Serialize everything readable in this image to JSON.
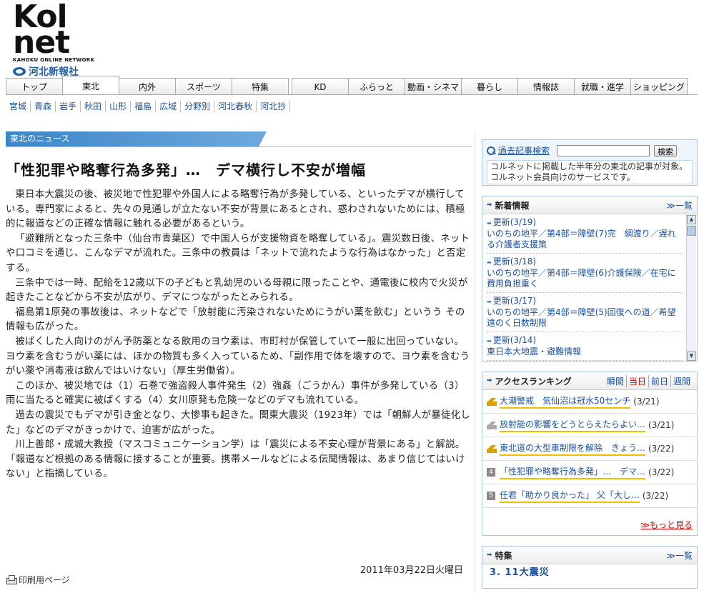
{
  "header": {
    "logo_top": "Kol",
    "logo_bottom": "net",
    "logo_sub": "KAHOKU ONLINE NETWORK",
    "publisher": "河北新報社"
  },
  "global_nav": [
    {
      "label": "トップ"
    },
    {
      "label": "東北",
      "active": true
    },
    {
      "label": "内外"
    },
    {
      "label": "スポーツ"
    },
    {
      "label": "特集"
    },
    {
      "label": "KD"
    },
    {
      "label": "ふらっと"
    },
    {
      "label": "動画・シネマ"
    },
    {
      "label": "暮らし"
    },
    {
      "label": "情報誌"
    },
    {
      "label": "就職・進学"
    },
    {
      "label": "ショッピング"
    }
  ],
  "sub_nav": [
    "宮城",
    "青森",
    "岩手",
    "秋田",
    "山形",
    "福島",
    "広域",
    "分野別",
    "河北春秋",
    "河北抄"
  ],
  "article": {
    "section": "東北のニュース",
    "title": "「性犯罪や略奪行為多発」…　デマ横行し不安が増幅",
    "paragraphs": [
      "東日本大震災の後、被災地で性犯罪や外国人による略奪行為が多発している、といったデマが横行している。専門家によると、先々の見通しが立たない不安が背景にあるとされ、惑わされないためには、積極的に報道などの正確な情報に触れる必要があるという。",
      "「避難所となった三条中（仙台市青葉区）で中国人らが支援物資を略奪している」。震災数日後、ネットや口コミを通じ、こんなデマが流れた。三条中の教員は「ネットで流れたような行為はなかった」と否定する。",
      "三条中では一時、配給を12歳以下の子どもと乳幼児のいる母親に限ったことや、通電後に校内で火災が起きたことなどから不安が広がり、デマにつながったとみられる。",
      "福島第1原発の事故後は、ネットなどで「放射能に汚染されないためにうがい薬を飲む」というう その情報も広がった。",
      "被ばくした人向けのがん予防薬となる飲用のヨウ素は、市町村が保管していて一般に出回っていない。ヨウ素を含むうがい薬には、ほかの物質も多く入っているため、「副作用で体を壊すので、ヨウ素を含むうがい薬や消毒液は飲んではいけない」（厚生労働省）。",
      "このほか、被災地では（1）石巻で強盗殺人事件発生（2）強姦（ごうかん）事件が多発している（3）雨に当たると確実に被ばくする（4）女川原発も危険一などのデマも流れている。",
      "過去の震災でもデマが引き金となり、大惨事も起きた。関東大震災（1923年）では「朝鮮人が暴徒化した」などのデマがきっかけで、迫害が広がった。",
      "川上善郎・成城大教授（マスコミュニケーション学）は「震災による不安心理が背景にある」と解説。「報道など根拠のある情報に接することが重要。携帯メールなどによる伝聞情報は、あまり信じてはいけない」と指摘している。"
    ],
    "date": "2011年03月22日火曜日",
    "print_label": "印刷用ページ"
  },
  "sidebar": {
    "search": {
      "title": "過去記事検索",
      "button": "検索",
      "input_value": "",
      "description": "コルネットに掲載した半年分の東北の記事が対象。コルネット会員向けのサービスです。"
    },
    "news": {
      "title": "新着情報",
      "more": "≫一覧",
      "items": [
        {
          "date": "更新(3/19)",
          "text": "いのちの地平／第4部＝障壁(7)完　綱渡り／遅れる介護者支援策"
        },
        {
          "date": "更新(3/18)",
          "text": "いのちの地平／第4部＝障壁(6)介護保険／在宅に費用負担重く"
        },
        {
          "date": "更新(3/17)",
          "text": "いのちの地平／第4部＝障壁(5)回復への道／希望遠のく日数制限"
        },
        {
          "date": "更新(3/14)",
          "text": "東日本大地震・避難情報"
        }
      ]
    },
    "ranking": {
      "title": "アクセスランキング",
      "tabs": [
        "瞬間",
        "当日",
        "前日",
        "週間"
      ],
      "active_tab": "当日",
      "items": [
        {
          "rank": "1",
          "text": "大潮警戒　気仙沼は冠水50センチ",
          "date": "(3/21)"
        },
        {
          "rank": "2",
          "text": "放射能の影響をどうとらえたらよい…",
          "date": "(3/21)"
        },
        {
          "rank": "3",
          "text": "東北道の大型車制限を解除　きょう…",
          "date": "(3/22)"
        },
        {
          "rank": "4",
          "text": "「性犯罪や略奪行為多発」…　デマ…",
          "date": "(3/22)"
        },
        {
          "rank": "5",
          "text": "任君「助かり良かった」 父「大し…",
          "date": "(3/22)"
        }
      ],
      "more": "≫もっと見る"
    },
    "feature": {
      "title": "特集",
      "more": "≫一覧",
      "item": "3. 11大震災"
    }
  },
  "colors": {
    "link": "#1a4f9c",
    "section_bar": "#3c86c8",
    "accent_red": "#d40000",
    "rank_underline": "#f0c000"
  }
}
